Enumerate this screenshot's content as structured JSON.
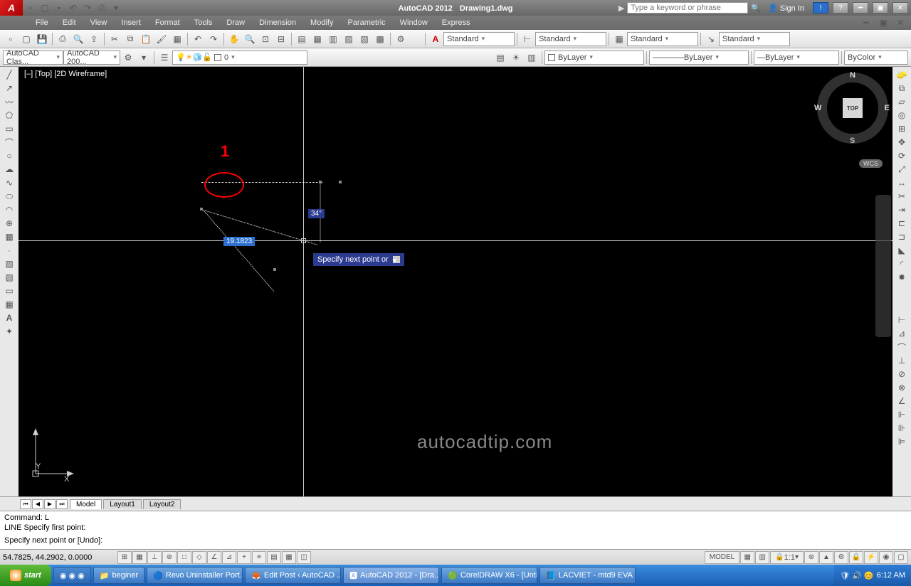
{
  "title": {
    "app": "AutoCAD 2012",
    "file": "Drawing1.dwg"
  },
  "qat_tb": [
    "⌕",
    "▾"
  ],
  "search_placeholder": "Type a keyword or phrase",
  "signin": "Sign In",
  "menus": [
    "File",
    "Edit",
    "View",
    "Insert",
    "Format",
    "Tools",
    "Draw",
    "Dimension",
    "Modify",
    "Parametric",
    "Window",
    "Express"
  ],
  "workspace_drop1": "AutoCAD Clas...",
  "workspace_drop2": "AutoCAD 200...",
  "layer_drop": "0",
  "layer_bylayer": "ByLayer",
  "color_bylayer": "ByLayer",
  "lw_bylayer": "ByLayer",
  "bycolor": "ByColor",
  "std": "Standard",
  "viewport_label": "[–] [Top] [2D Wireframe]",
  "dim_length": "19.1823",
  "dim_angle": "34°",
  "tooltip_text": "Specify next point or",
  "annot_1": "1",
  "watermark": "autocadtip.com",
  "viewcube": {
    "face": "TOP",
    "n": "N",
    "s": "S",
    "e": "E",
    "w": "W",
    "wcs": "WCS"
  },
  "ucs": {
    "x": "X",
    "y": "Y"
  },
  "tabs": {
    "model": "Model",
    "l1": "Layout1",
    "l2": "Layout2"
  },
  "cmd": {
    "l1": "Command: L",
    "l2": "LINE Specify first point:",
    "l3": "Specify next point or [Undo]:"
  },
  "status": {
    "coords": "54.7825, 44.2902, 0.0000",
    "model": "MODEL",
    "scale": "1:1"
  },
  "taskbar": {
    "start": "start",
    "items": [
      "beginer",
      "Revo Uninstaller Port...",
      "Edit Post ‹ AutoCAD ...",
      "AutoCAD 2012 - [Dra...",
      "CorelDRAW X6 - [Unti...",
      "LACVIET - mtd9 EVA ..."
    ],
    "time": "6:12 AM"
  }
}
